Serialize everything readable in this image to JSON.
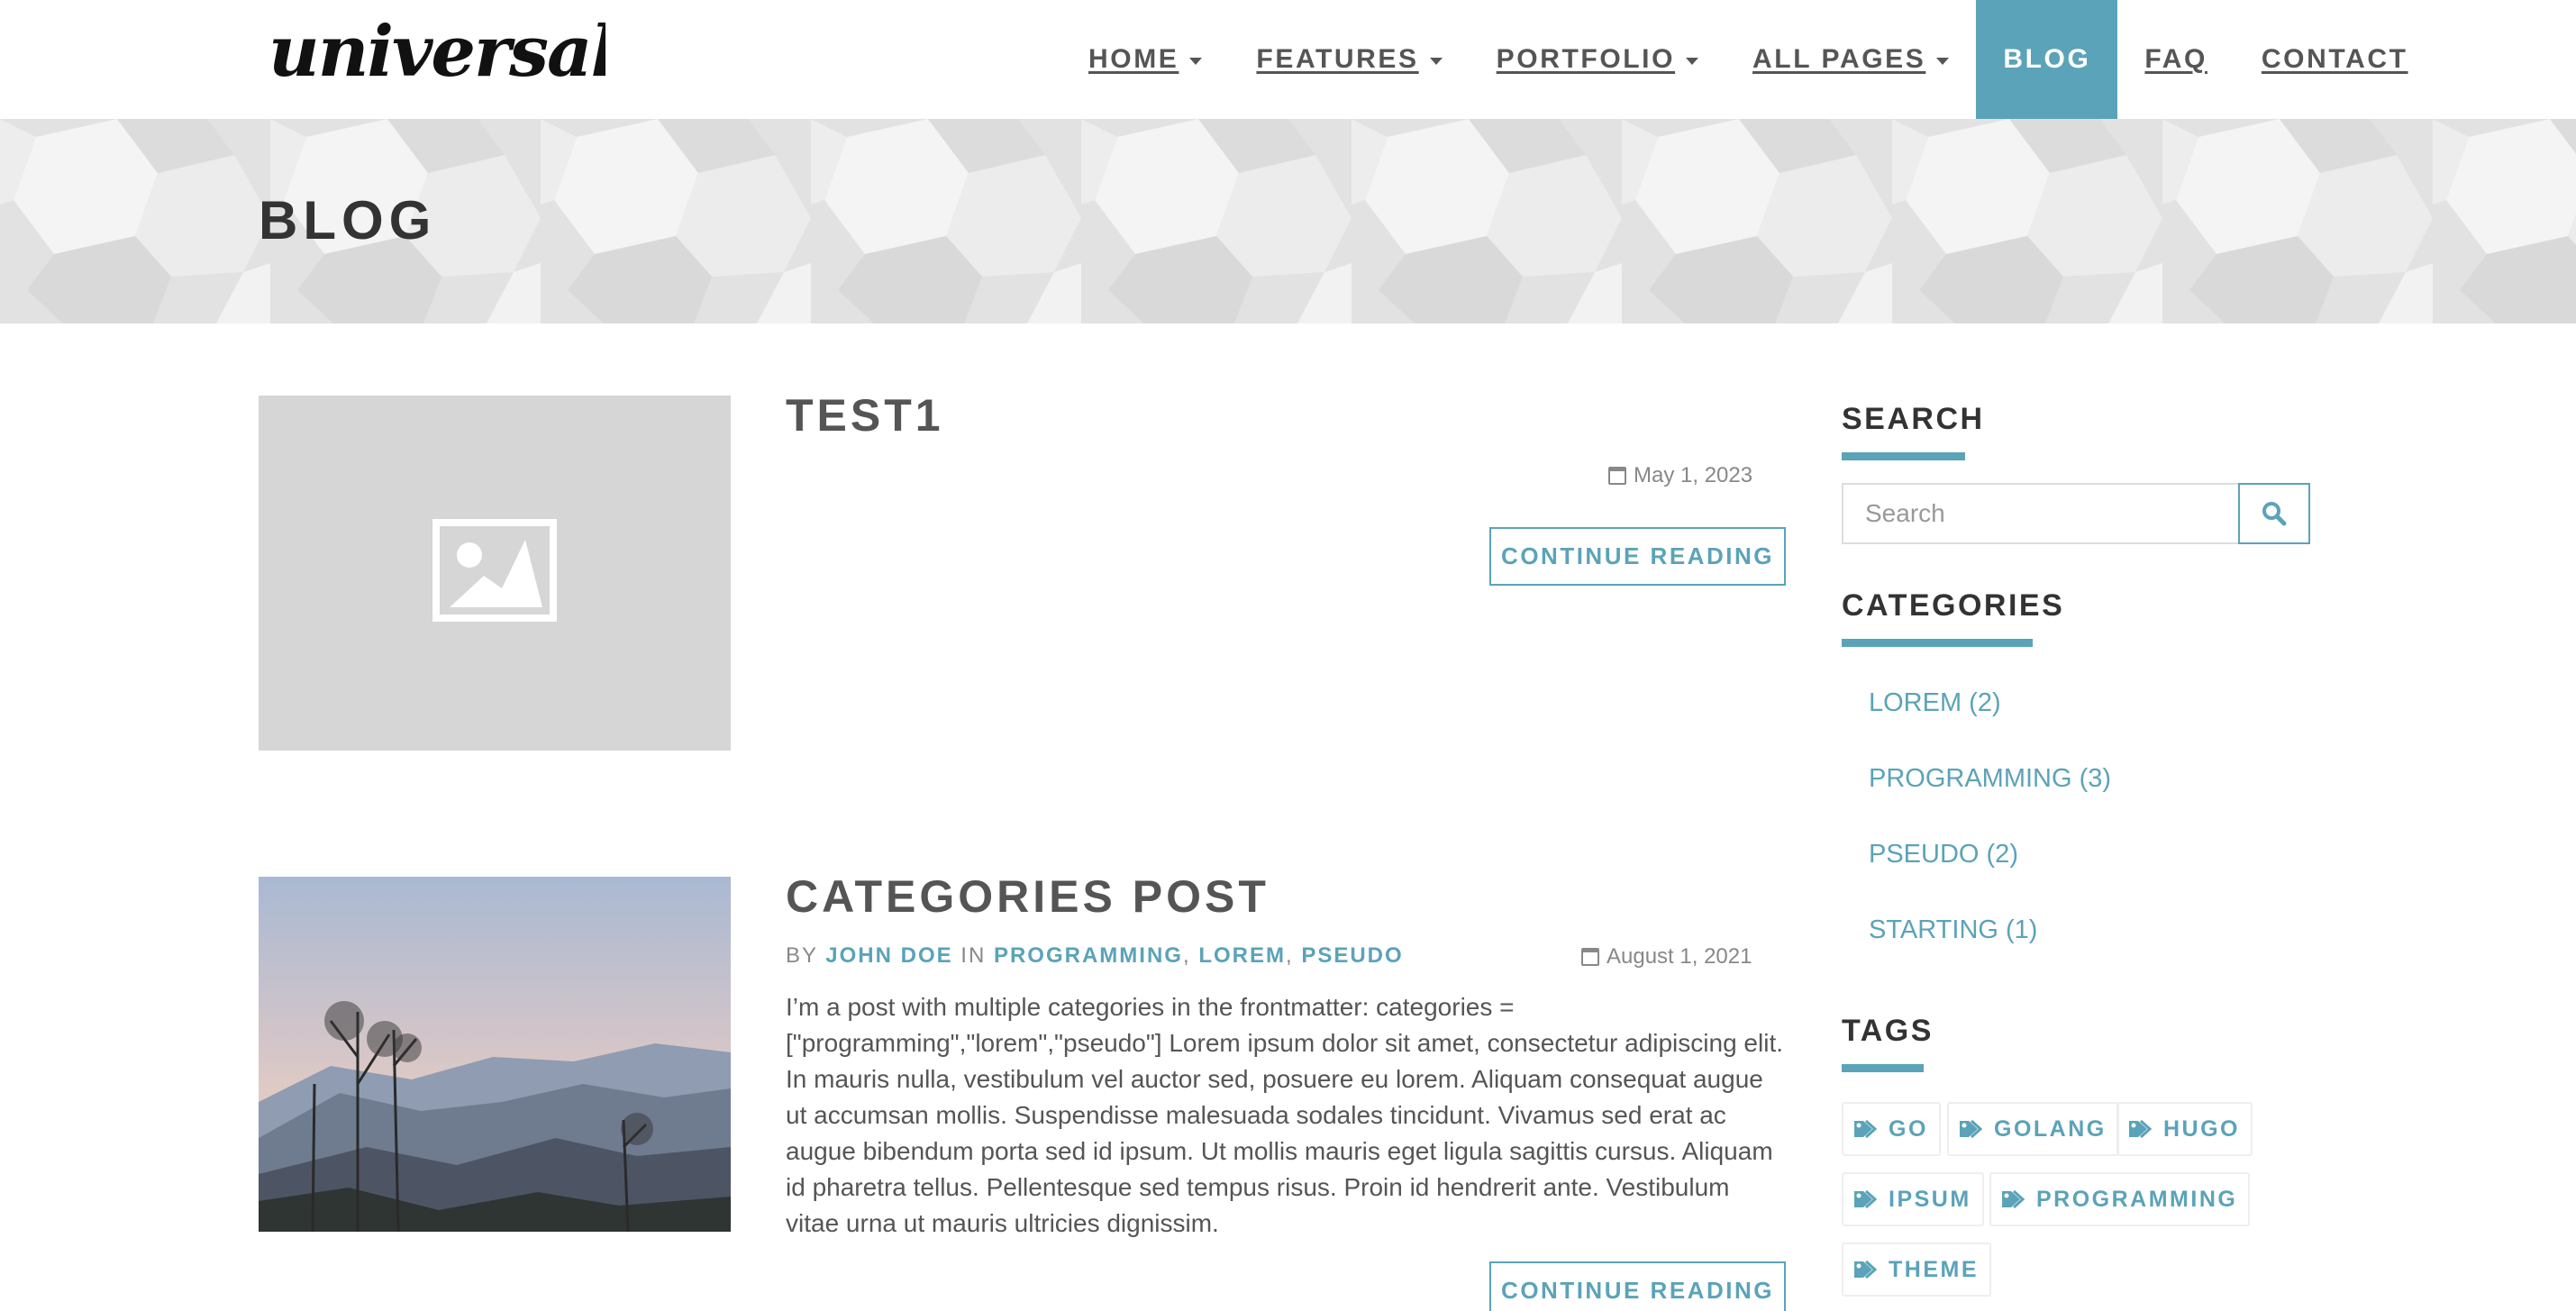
{
  "site": {
    "logo_text": "universal"
  },
  "nav": {
    "items": [
      {
        "label": "HOME",
        "dropdown": true
      },
      {
        "label": "FEATURES",
        "dropdown": true
      },
      {
        "label": "PORTFOLIO",
        "dropdown": true
      },
      {
        "label": "ALL PAGES",
        "dropdown": true
      },
      {
        "label": "BLOG",
        "dropdown": false,
        "active": true
      },
      {
        "label": "FAQ",
        "dropdown": false
      },
      {
        "label": "CONTACT",
        "dropdown": false
      }
    ]
  },
  "banner": {
    "title": "BLOG"
  },
  "posts": [
    {
      "title": "TEST1",
      "date": "May 1, 2023",
      "thumbnail": "placeholder-image-icon",
      "continue_label": "CONTINUE READING"
    },
    {
      "title": "CATEGORIES POST",
      "by_label": "BY",
      "author": "JOHN DOE",
      "in_label": "IN",
      "categories": [
        "PROGRAMMING",
        "LOREM",
        "PSEUDO"
      ],
      "separator": ",",
      "date": "August 1, 2021",
      "thumbnail": "mountain-landscape-photo",
      "excerpt": "I’m a post with multiple categories in the frontmatter: categories = [\"programming\",\"lorem\",\"pseudo\"] Lorem ipsum dolor sit amet, consectetur adipiscing elit. In mauris nulla, vestibulum vel auctor sed, posuere eu lorem. Aliquam consequat augue ut accumsan mollis. Suspendisse malesuada sodales tincidunt. Vivamus sed erat ac augue bibendum porta sed id ipsum. Ut mollis mauris eget ligula sagittis cursus. Aliquam id pharetra tellus. Pellentesque sed tempus risus. Proin id hendrerit ante. Vestibulum vitae urna ut mauris ultricies dignissim.",
      "continue_label": "CONTINUE READING"
    }
  ],
  "sidebar": {
    "search": {
      "heading": "SEARCH",
      "placeholder": "Search",
      "button_icon": "search-icon"
    },
    "categories": {
      "heading": "CATEGORIES",
      "items": [
        "LOREM (2)",
        "PROGRAMMING (3)",
        "PSEUDO (2)",
        "STARTING (1)"
      ]
    },
    "tags": {
      "heading": "TAGS",
      "items": [
        "GO",
        "GOLANG",
        "HUGO",
        "IPSUM",
        "PROGRAMMING",
        "THEME"
      ]
    }
  },
  "colors": {
    "accent": "#5ba3b8",
    "heading": "#333333",
    "body": "#555555",
    "muted": "#888888"
  }
}
